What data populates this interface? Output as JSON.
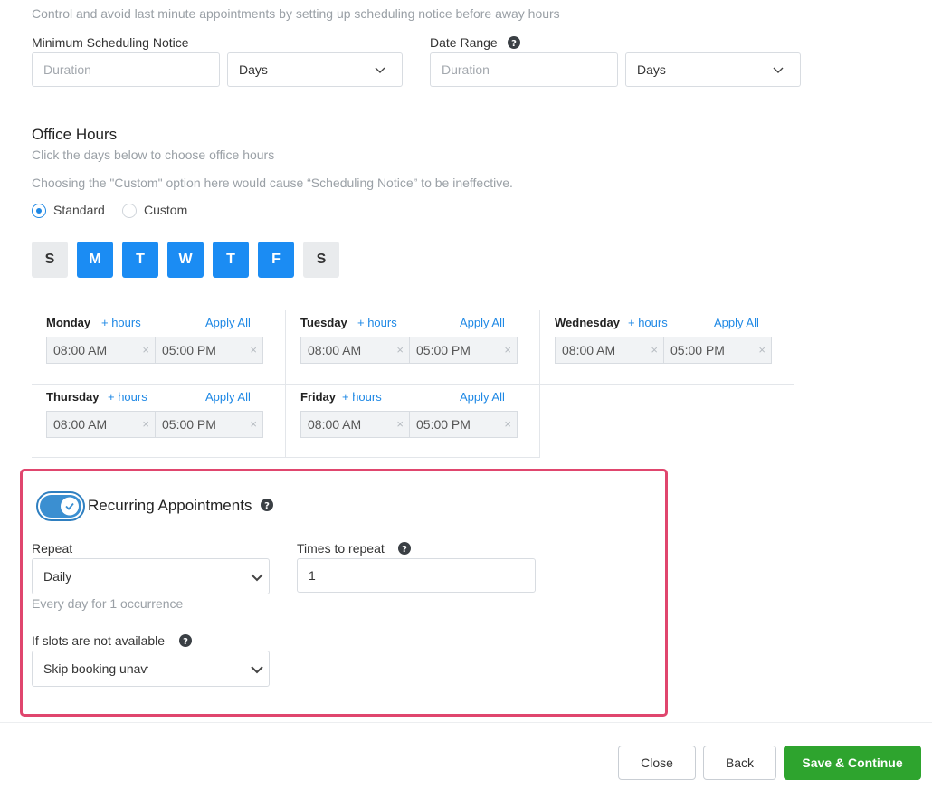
{
  "scheduling": {
    "notice_desc": "Control and avoid last minute appointments by setting up scheduling notice before away hours",
    "min_notice_label": "Minimum Scheduling Notice",
    "min_notice_placeholder": "Duration",
    "min_notice_unit": "Days",
    "date_range_label": "Date Range",
    "date_range_placeholder": "Duration",
    "date_range_unit": "Days"
  },
  "office_hours": {
    "title": "Office Hours",
    "subtitle": "Click the days below to choose office hours",
    "custom_warning": "Choosing the \"Custom\" option here would cause “Scheduling Notice” to be ineffective.",
    "mode_standard": "Standard",
    "mode_custom": "Custom",
    "selected_mode": "Standard",
    "days": [
      {
        "letter": "S",
        "selected": false
      },
      {
        "letter": "M",
        "selected": true
      },
      {
        "letter": "T",
        "selected": true
      },
      {
        "letter": "W",
        "selected": true
      },
      {
        "letter": "T",
        "selected": true
      },
      {
        "letter": "F",
        "selected": true
      },
      {
        "letter": "S",
        "selected": false
      }
    ],
    "add_hours_label": "+ hours",
    "apply_all_label": "Apply All",
    "schedule": [
      {
        "day": "Monday",
        "start": "08:00 AM",
        "end": "05:00 PM"
      },
      {
        "day": "Tuesday",
        "start": "08:00 AM",
        "end": "05:00 PM"
      },
      {
        "day": "Wednesday",
        "start": "08:00 AM",
        "end": "05:00 PM"
      },
      {
        "day": "Thursday",
        "start": "08:00 AM",
        "end": "05:00 PM"
      },
      {
        "day": "Friday",
        "start": "08:00 AM",
        "end": "05:00 PM"
      }
    ]
  },
  "recurring": {
    "title": "Recurring Appointments",
    "enabled": true,
    "repeat_label": "Repeat",
    "repeat_value": "Daily",
    "repeat_summary": "Every day for 1 occurrence",
    "times_label": "Times to repeat",
    "times_value": "1",
    "unavailable_label": "If slots are not available",
    "unavailable_value": "Skip booking unaѵ"
  },
  "footer": {
    "close_label": "Close",
    "back_label": "Back",
    "save_label": "Save & Continue"
  },
  "colors": {
    "accent": "#1b8cf3",
    "highlight_border": "#e0466e",
    "save_button": "#2ea42e"
  }
}
